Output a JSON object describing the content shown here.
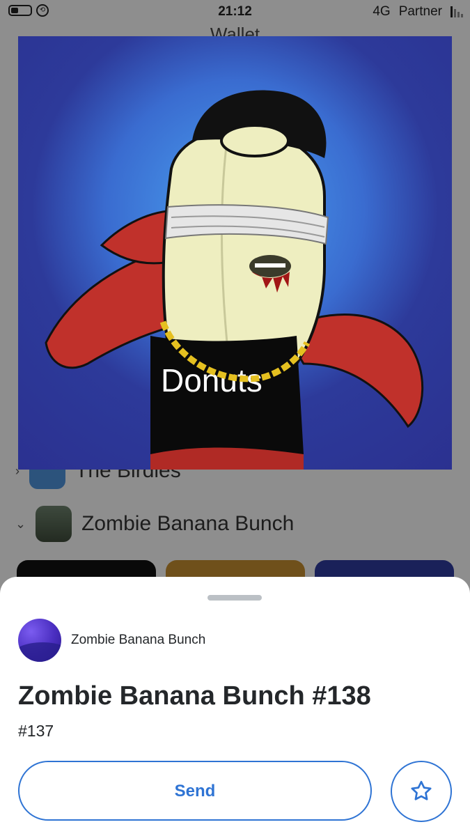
{
  "status_bar": {
    "time": "21:12",
    "network": "4G",
    "carrier": "Partner"
  },
  "background": {
    "title": "Wallet",
    "collections": [
      {
        "name": "The Birdies"
      },
      {
        "name": "Zombie Banana Bunch"
      }
    ]
  },
  "nft_image": {
    "shirt_text": "Donuts"
  },
  "sheet": {
    "collection_name": "Zombie Banana Bunch",
    "nft_title": "Zombie Banana Bunch #138",
    "nft_id": "#137",
    "send_label": "Send",
    "favorite_icon": "star-outline-icon"
  },
  "colors": {
    "accent": "#2f74d4",
    "text": "#24272a",
    "image_background": "#2d3a9a"
  }
}
